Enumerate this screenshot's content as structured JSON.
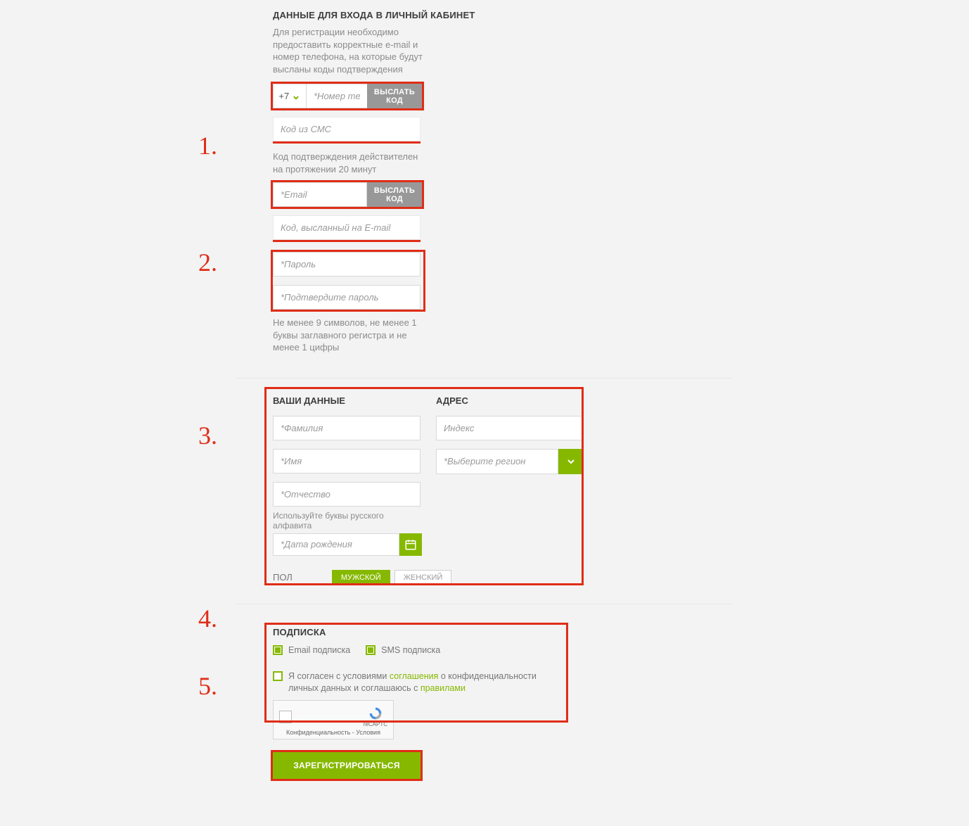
{
  "steps": {
    "s1": "1.",
    "s2": "2.",
    "s3": "3.",
    "s4": "4.",
    "s5": "5."
  },
  "login": {
    "heading": "ДАННЫЕ ДЛЯ ВХОДА В ЛИЧНЫЙ КАБИНЕТ",
    "intro": "Для регистрации необходимо предоставить корректные e-mail и номер телефона, на которые будут высланы коды подтверждения",
    "phone_prefix": "+7",
    "phone_placeholder": "*Номер телефона",
    "send_code_btn": "ВЫСЛАТЬ КОД",
    "sms_code_placeholder": "Код из СМС",
    "code_valid_note": "Код подтверждения действителен на протяжении 20 минут",
    "email_placeholder": "*Email",
    "email_code_placeholder": "Код, высланный на E-mail",
    "password_placeholder": "*Пароль",
    "password_confirm_placeholder": "*Подтвердите пароль",
    "password_rule": "Не менее 9 символов, не менее 1 буквы заглавного регистра и не менее 1 цифры"
  },
  "profile": {
    "heading": "ВАШИ ДАННЫЕ",
    "address_heading": "АДРЕС",
    "lastname_placeholder": "*Фамилия",
    "firstname_placeholder": "*Имя",
    "patronymic_placeholder": "*Отчество",
    "alphabet_note": "Используйте буквы русского алфавита",
    "dob_placeholder": "*Дата рождения",
    "zip_placeholder": "Индекс",
    "region_placeholder": "*Выберите регион",
    "gender_label": "ПОЛ",
    "gender_male": "МУЖСКОЙ",
    "gender_female": "ЖЕНСКИЙ"
  },
  "subscribe": {
    "heading": "ПОДПИСКА",
    "opt_email": "Email подписка",
    "opt_sms": "SMS подписка",
    "agree_prefix": "Я согласен с условиями ",
    "agree_link1": "соглашения",
    "agree_mid": " о конфиденциальности личных данных и соглашаюсь с ",
    "agree_link2": "правилами",
    "captcha_brand": "reCAPTC",
    "captcha_footer": "Конфиденциальность - Условия"
  },
  "register_btn": "ЗАРЕГИСТРИРОВАТЬСЯ"
}
